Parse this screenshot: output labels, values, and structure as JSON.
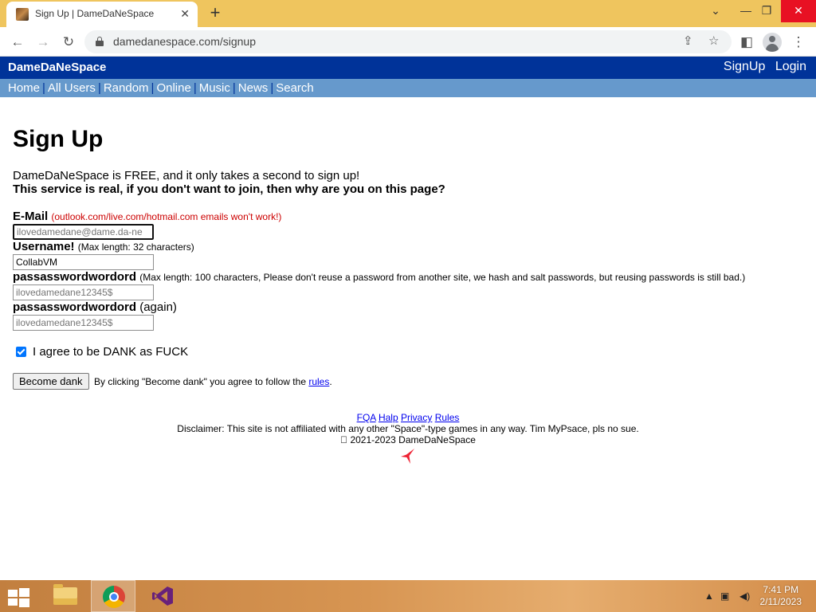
{
  "browser": {
    "tab_title": "Sign Up | DameDaNeSpace",
    "url": "damedanespace.com/signup",
    "icons": [
      "back-icon",
      "forward-icon",
      "reload-icon",
      "lock-icon",
      "share-icon",
      "bookmark-star-icon",
      "side-panel-icon",
      "profile-icon",
      "menu-icon"
    ]
  },
  "site": {
    "brand": "DameDaNeSpace",
    "auth": {
      "signup": "SignUp",
      "login": "Login"
    },
    "nav": [
      {
        "label": "Home"
      },
      {
        "label": "All Users"
      },
      {
        "label": "Random"
      },
      {
        "label": "Online"
      },
      {
        "label": "Music"
      },
      {
        "label": "News"
      },
      {
        "label": "Search"
      }
    ],
    "colors": {
      "header": "#003399",
      "nav": "#6699cc",
      "link": "#0000ee",
      "warning": "#cc0000"
    }
  },
  "form": {
    "title": "Sign Up",
    "intro": "DameDaNeSpace is FREE, and it only takes a second to sign up!",
    "intro_bold": "This service is real, if you don't want to join, then why are you on this page?",
    "email": {
      "label": "E-Mail",
      "note": "(outlook.com/live.com/hotmail.com emails won't work!)",
      "placeholder": "ilovedamedane@dame.da-ne",
      "value": ""
    },
    "username": {
      "label": "Username!",
      "note": "(Max length: 32 characters)",
      "placeholder": "",
      "value": "CollabVM"
    },
    "password": {
      "label": "passasswordwordord",
      "note": "(Max length: 100 characters, Please don't reuse a password from another site, we hash and salt passwords, but reusing passwords is still bad.)",
      "placeholder": "ilovedamedane12345$",
      "value": ""
    },
    "password_again": {
      "label": "passasswordwordord",
      "note": "(again)",
      "placeholder": "ilovedamedane12345$",
      "value": ""
    },
    "agree": {
      "label": "I agree to be DANK as FUCK",
      "checked": true
    },
    "submit": {
      "label": "Become dank",
      "note_prefix": "By clicking \"Become dank\" you agree to follow the",
      "rules_link": "rules",
      "note_suffix": "."
    }
  },
  "footer": {
    "links": [
      {
        "label": "FQA"
      },
      {
        "label": "Halp"
      },
      {
        "label": "Privacy"
      },
      {
        "label": "Rules"
      }
    ],
    "disclaimer": "Disclaimer: This site is not affiliated with any other \"Space\"-type games in any way. Tim MyPsace, pls no sue.",
    "copyright": "\u0000 2021-2023 DameDaNeSpace",
    "star_icon": "red-star-icon"
  },
  "taskbar": {
    "apps": [
      "windows-start-icon",
      "file-explorer-icon",
      "chrome-icon",
      "visual-studio-icon"
    ],
    "time": "7:41 PM",
    "date": "2/11/2023"
  }
}
